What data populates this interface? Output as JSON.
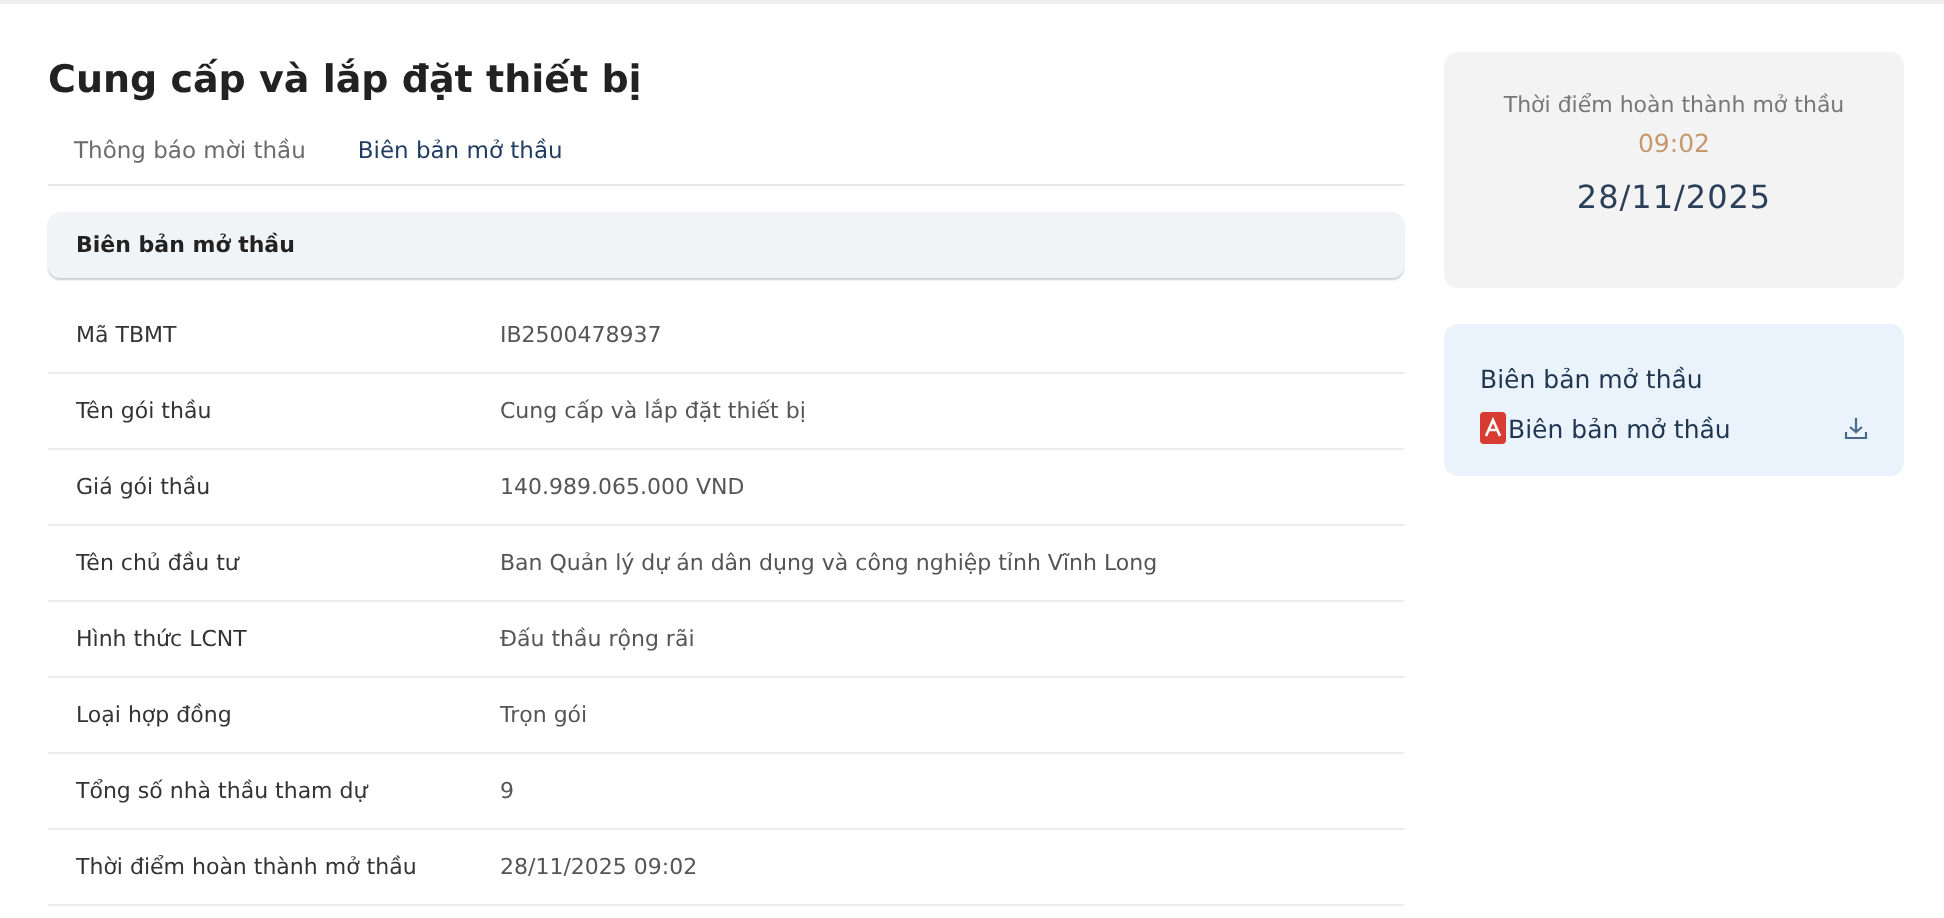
{
  "title": "Cung cấp và lắp đặt thiết bị",
  "tabs": [
    {
      "label": "Thông báo mời thầu",
      "selected": false
    },
    {
      "label": "Biên bản mở thầu",
      "selected": true
    }
  ],
  "section": {
    "title": "Biên bản mở thầu"
  },
  "rows": [
    {
      "label": "Mã TBMT",
      "value": "IB2500478937"
    },
    {
      "label": "Tên gói thầu",
      "value": "Cung cấp và lắp đặt thiết bị"
    },
    {
      "label": "Giá gói thầu",
      "value": "140.989.065.000 VND"
    },
    {
      "label": "Tên chủ đầu tư",
      "value": "Ban Quản lý dự án dân dụng và công nghiệp tỉnh Vĩnh Long"
    },
    {
      "label": "Hình thức LCNT",
      "value": "Đấu thầu rộng rãi"
    },
    {
      "label": "Loại hợp đồng",
      "value": "Trọn gói"
    },
    {
      "label": "Tổng số nhà thầu tham dự",
      "value": "9"
    },
    {
      "label": "Thời điểm hoàn thành mở thầu",
      "value": "28/11/2025 09:02"
    }
  ],
  "completion": {
    "label": "Thời điểm hoàn thành mở thầu",
    "time": "09:02",
    "date": "28/11/2025"
  },
  "documents": {
    "title": "Biên bản mở thầu",
    "files": [
      {
        "name": "Biên bản mở thầu"
      }
    ]
  }
}
